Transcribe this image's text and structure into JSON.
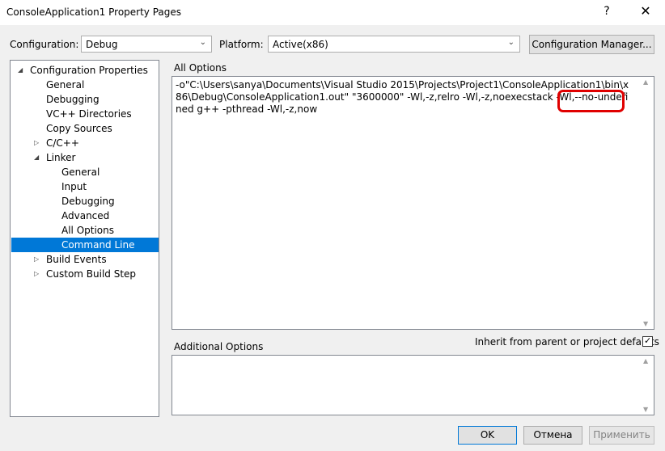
{
  "window": {
    "title": "ConsoleApplication1 Property Pages",
    "help_glyph": "?",
    "close_glyph": "✕"
  },
  "config_bar": {
    "configuration_label": "Configuration:",
    "configuration_value": "Debug",
    "platform_label": "Platform:",
    "platform_value": "Active(x86)",
    "config_manager_button": "Configuration Manager..."
  },
  "tree": {
    "items": [
      {
        "label": "Configuration Properties",
        "expander": "◢"
      },
      {
        "label": "General"
      },
      {
        "label": "Debugging"
      },
      {
        "label": "VC++ Directories"
      },
      {
        "label": "Copy Sources"
      },
      {
        "label": "C/C++",
        "expander": "▷"
      },
      {
        "label": "Linker",
        "expander": "◢"
      },
      {
        "label": "General"
      },
      {
        "label": "Input"
      },
      {
        "label": "Debugging"
      },
      {
        "label": "Advanced"
      },
      {
        "label": "All Options"
      },
      {
        "label": "Command Line",
        "selected": true
      },
      {
        "label": "Build Events",
        "expander": "▷"
      },
      {
        "label": "Custom Build Step",
        "expander": "▷"
      }
    ]
  },
  "all_options": {
    "label": "All Options",
    "text_before": "-o\"C:\\Users\\sanya\\Documents\\Visual Studio 2015\\Projects\\Project1\\ConsoleApplication1\\bin\\x86\\Debug\\ConsoleApplication1.out\" \"3600000\" -Wl,-z,relro -Wl,-z,noexecstack -Wl,--no-undefined ",
    "text_highlighted": "g++ -pthread",
    "text_after": " -Wl,-z,now"
  },
  "additional_options": {
    "label": "Additional Options",
    "value": "",
    "inherit_label": "Inherit from parent or project defaults",
    "inherit_checked": true
  },
  "buttons": {
    "ok": "OK",
    "cancel": "Отмена",
    "apply": "Применить"
  },
  "colors": {
    "selection": "#0078d7",
    "highlight_box": "#e00000"
  }
}
